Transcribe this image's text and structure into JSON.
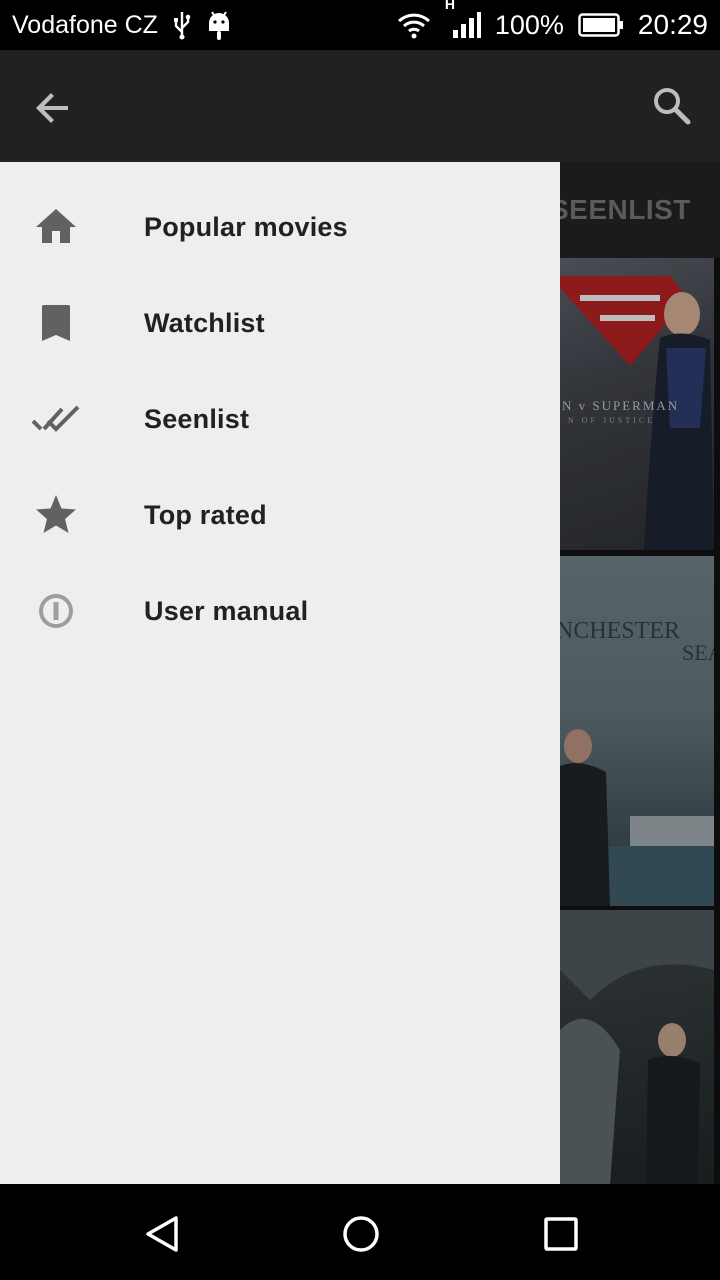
{
  "status_bar": {
    "carrier": "Vodafone CZ",
    "network_type": "H",
    "battery": "100%",
    "time": "20:29",
    "icons": [
      "usb-icon",
      "android-icon",
      "wifi-icon",
      "signal-icon",
      "battery-icon"
    ]
  },
  "app_bar": {
    "back_icon": "arrow-back-icon",
    "search_icon": "search-icon"
  },
  "background": {
    "tab_label": "SEENLIST",
    "posters": [
      {
        "title": "N v SUPERMAN",
        "subtitle": "N OF JUSTICE"
      },
      {
        "title": "NCHESTER",
        "subtitle": "SEA"
      },
      {
        "title": ""
      }
    ]
  },
  "drawer": {
    "items": [
      {
        "label": "Popular movies",
        "icon": "home-icon"
      },
      {
        "label": "Watchlist",
        "icon": "bookmark-icon"
      },
      {
        "label": "Seenlist",
        "icon": "double-check-icon"
      },
      {
        "label": "Top rated",
        "icon": "star-icon"
      },
      {
        "label": "User manual",
        "icon": "info-icon"
      }
    ]
  },
  "nav_bar": {
    "buttons": [
      "back-triangle-icon",
      "home-circle-icon",
      "recents-square-icon"
    ]
  },
  "colors": {
    "app_bar": "#212121",
    "drawer_bg": "#eeeeee",
    "drawer_text": "#212121",
    "drawer_icon": "#616161"
  }
}
